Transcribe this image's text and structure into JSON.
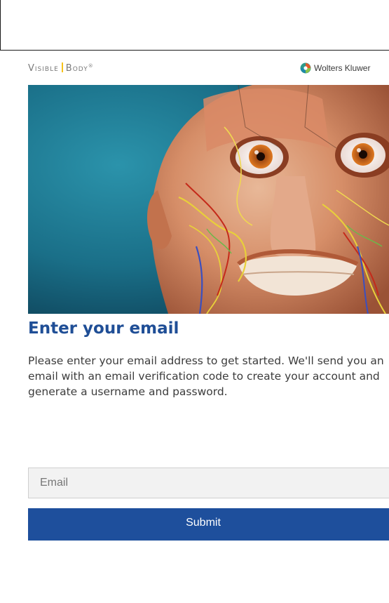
{
  "header": {
    "brand_part1": "Visible",
    "brand_part2": "Body",
    "brand_tm": "®",
    "partner_name": "Wolters Kluwer",
    "divider_color": "#f6c21a"
  },
  "hero": {
    "image_subject": "anatomical-head-illustration",
    "background_color": "#1d7f98"
  },
  "form": {
    "title": "Enter your email",
    "description": "Please enter your email address to get started. We'll send you an email with an email verification code to create your account and generate a username and password.",
    "email_placeholder": "Email",
    "email_value": "",
    "submit_label": "Submit",
    "accent_color": "#1e4f9c"
  }
}
